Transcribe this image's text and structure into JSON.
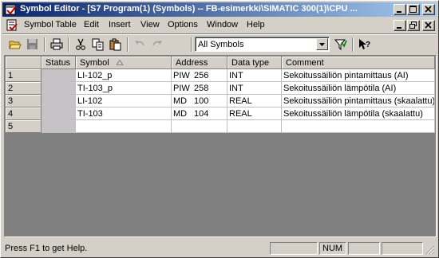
{
  "window": {
    "title": "Symbol Editor - [S7 Program(1) (Symbols) -- FB-esimerkki\\SIMATIC 300(1)\\CPU ..."
  },
  "menu": {
    "items": [
      "Symbol Table",
      "Edit",
      "Insert",
      "View",
      "Options",
      "Window",
      "Help"
    ]
  },
  "toolbar": {
    "filter_value": "All Symbols",
    "icons": [
      "open-icon",
      "save-icon",
      "print-icon",
      "cut-icon",
      "copy-icon",
      "paste-icon",
      "undo-icon",
      "redo-icon",
      "filter-icon",
      "whats-this-help-icon"
    ]
  },
  "table": {
    "columns": [
      "Status",
      "Symbol",
      "Address",
      "Data type",
      "Comment"
    ],
    "sort_column": "Symbol",
    "rows": [
      {
        "num": "1",
        "status": "",
        "symbol": "LI-102_p",
        "addr_type": "PIW",
        "addr_num": "256",
        "data_type": "INT",
        "comment": "Sekoitussäiliön pintamittaus (AI)"
      },
      {
        "num": "2",
        "status": "",
        "symbol": "TI-103_p",
        "addr_type": "PIW",
        "addr_num": "258",
        "data_type": "INT",
        "comment": "Sekoitussäiliön lämpötila (AI)"
      },
      {
        "num": "3",
        "status": "",
        "symbol": "LI-102",
        "addr_type": "MD",
        "addr_num": "100",
        "data_type": "REAL",
        "comment": "Sekoitussäiliön pintamittaus (skaalattu)"
      },
      {
        "num": "4",
        "status": "",
        "symbol": "TI-103",
        "addr_type": "MD",
        "addr_num": "104",
        "data_type": "REAL",
        "comment": "Sekoitussäiliön lämpötila (skaalattu)"
      },
      {
        "num": "5",
        "status": "",
        "symbol": "",
        "addr_type": "",
        "addr_num": "",
        "data_type": "",
        "comment": ""
      }
    ]
  },
  "statusbar": {
    "message": "Press F1 to get Help.",
    "num": "NUM"
  }
}
